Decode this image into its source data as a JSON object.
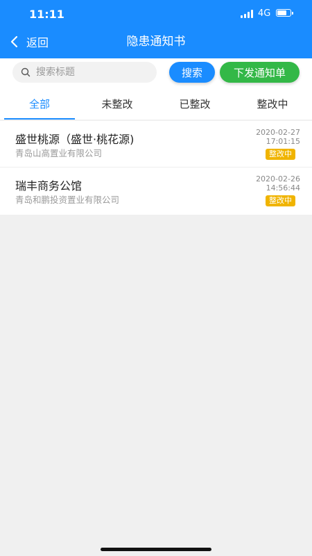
{
  "status_bar": {
    "time": "11:11",
    "network": "4G"
  },
  "nav": {
    "back_label": "返回",
    "title": "隐患通知书"
  },
  "search": {
    "placeholder": "搜索标题",
    "value": "",
    "search_button": "搜索",
    "issue_button": "下发通知单"
  },
  "tabs": [
    {
      "label": "全部",
      "active": true
    },
    {
      "label": "未整改",
      "active": false
    },
    {
      "label": "已整改",
      "active": false
    },
    {
      "label": "整改中",
      "active": false
    }
  ],
  "items": [
    {
      "name": "盛世桃源（盛世·桃花源)",
      "company": "青岛山高置业有限公司",
      "date": "2020-02-27",
      "time": "17:01:15",
      "status": "整改中"
    },
    {
      "name": "瑞丰商务公馆",
      "company": "青岛和鹏投资置业有限公司",
      "date": "2020-02-26",
      "time": "14:56:44",
      "status": "整改中"
    }
  ],
  "colors": {
    "primary": "#1a8cff",
    "issue_button": "#33b847",
    "badge": "#f0b400",
    "background": "#f0f0f0"
  },
  "icons": [
    "back-arrow-icon",
    "search-icon",
    "signal-icon",
    "battery-icon"
  ]
}
